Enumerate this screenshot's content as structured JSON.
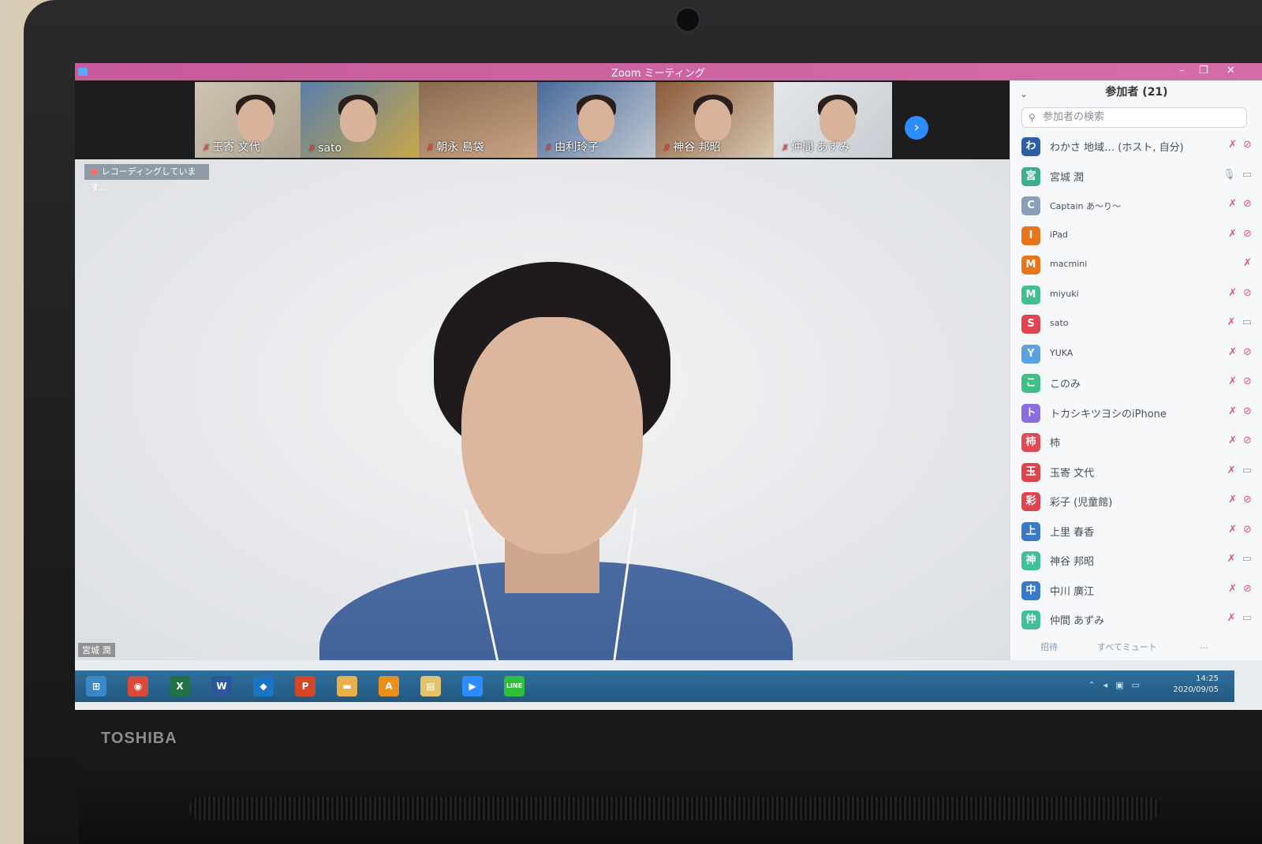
{
  "window": {
    "title": "Zoom ミーティング",
    "minimize": "–",
    "restore": "❐",
    "close": "✕"
  },
  "thumbnails": [
    {
      "name": "玉寄 文代"
    },
    {
      "name": "sato"
    },
    {
      "name": "朝永 島袋"
    },
    {
      "name": "由利玲子"
    },
    {
      "name": "神谷 邦昭"
    },
    {
      "name": "仲間 あずみ"
    }
  ],
  "thumbnail_next_icon": "chevron-right-icon",
  "recording": {
    "label": "レコーディングしています..."
  },
  "main_video": {
    "name_tag": "宮城 潤"
  },
  "participants_panel": {
    "title": "参加者 (21)",
    "search_placeholder": "参加者の検索",
    "participants": [
      {
        "initial": "わ",
        "name": "わかさ 地域… (ホスト, 自分)",
        "color": "#2d5fa8",
        "mic": "muted",
        "video": "off"
      },
      {
        "initial": "宮",
        "name": "宮城 潤",
        "color": "#3fae8c",
        "mic": "on",
        "video": "on"
      },
      {
        "initial": "C",
        "name": "Captain あ〜り〜",
        "color": "#8aa0b8",
        "mic": "muted",
        "video": "off"
      },
      {
        "initial": "I",
        "name": "iPad",
        "color": "#e8751a",
        "mic": "muted",
        "video": "off"
      },
      {
        "initial": "M",
        "name": "macmini",
        "color": "#e8751a",
        "mic": "muted",
        "video": "none"
      },
      {
        "initial": "M",
        "name": "miyuki",
        "color": "#3fc28f",
        "mic": "muted",
        "video": "off"
      },
      {
        "initial": "S",
        "name": "sato",
        "color": "#e0444f",
        "mic": "muted",
        "video": "on"
      },
      {
        "initial": "Y",
        "name": "YUKA",
        "color": "#5aa3e0",
        "mic": "muted",
        "video": "off"
      },
      {
        "initial": "こ",
        "name": "このみ",
        "color": "#3fbf86",
        "mic": "muted",
        "video": "off"
      },
      {
        "initial": "ト",
        "name": "トカシキツヨシのiPhone",
        "color": "#8a6ee0",
        "mic": "muted",
        "video": "off"
      },
      {
        "initial": "柿",
        "name": "柿",
        "color": "#e04a55",
        "mic": "muted",
        "video": "off"
      },
      {
        "initial": "玉",
        "name": "玉寄 文代",
        "color": "#e0444f",
        "mic": "muted",
        "video": "on"
      },
      {
        "initial": "彩",
        "name": "彩子 (児童館)",
        "color": "#e0444f",
        "mic": "muted",
        "video": "off"
      },
      {
        "initial": "上",
        "name": "上里 春香",
        "color": "#3a78c8",
        "mic": "muted",
        "video": "off"
      },
      {
        "initial": "神",
        "name": "神谷 邦昭",
        "color": "#3fbf9a",
        "mic": "muted",
        "video": "on"
      },
      {
        "initial": "中",
        "name": "中川 廣江",
        "color": "#3a78c8",
        "mic": "muted",
        "video": "off"
      },
      {
        "initial": "仲",
        "name": "仲間 あずみ",
        "color": "#3fbf9a",
        "mic": "muted",
        "video": "on"
      }
    ],
    "footer": {
      "invite": "招待",
      "mute_all": "すべてミュート",
      "more": "..."
    }
  },
  "taskbar": {
    "apps": [
      {
        "icon": "windows-start-icon",
        "label": "⊞",
        "color": "#3a88c8"
      },
      {
        "icon": "chrome-icon",
        "label": "◉",
        "color": "#d94a3a"
      },
      {
        "icon": "excel-icon",
        "label": "X",
        "color": "#217346"
      },
      {
        "icon": "word-icon",
        "label": "W",
        "color": "#2b579a"
      },
      {
        "icon": "outlook-icon",
        "label": "◆",
        "color": "#1a74c4"
      },
      {
        "icon": "powerpoint-icon",
        "label": "P",
        "color": "#d24726"
      },
      {
        "icon": "folder-icon",
        "label": "▬",
        "color": "#e8b04a"
      },
      {
        "icon": "access-icon",
        "label": "A",
        "color": "#e8901a"
      },
      {
        "icon": "file-explorer-icon",
        "label": "▤",
        "color": "#e2c26a"
      },
      {
        "icon": "zoom-icon",
        "label": "▶",
        "color": "#2d8cff"
      },
      {
        "icon": "line-icon",
        "label": "LINE",
        "color": "#2fbf3a"
      }
    ],
    "clock_time": "14:25",
    "clock_date": "2020/09/05"
  },
  "device": {
    "brand": "TOSHIBA"
  }
}
